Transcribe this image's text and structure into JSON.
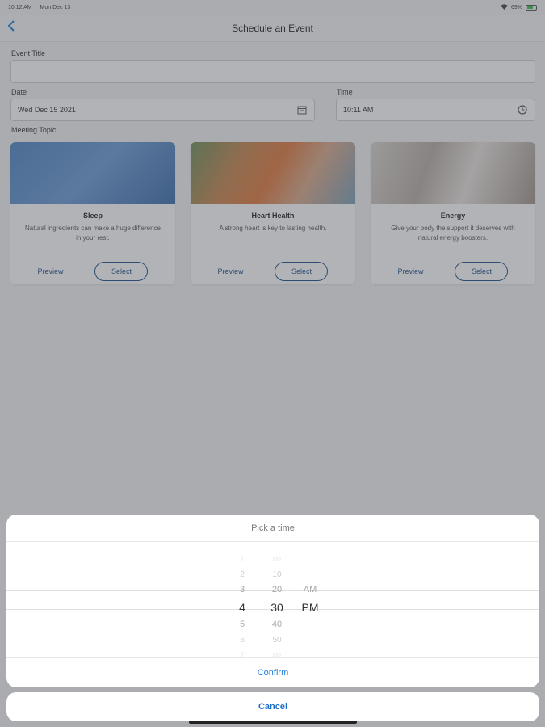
{
  "status": {
    "time": "10:12 AM",
    "date": "Mon Dec 13",
    "battery": "69%"
  },
  "nav": {
    "title": "Schedule an Event"
  },
  "form": {
    "event_title_label": "Event Title",
    "event_title_value": "",
    "date_label": "Date",
    "date_value": "Wed Dec 15 2021",
    "time_label": "Time",
    "time_value": "10:11 AM",
    "topic_label": "Meeting Topic"
  },
  "topics": [
    {
      "title": "Sleep",
      "desc": "Natural ingredients can make a huge difference in your rest.",
      "preview": "Preview",
      "select": "Select"
    },
    {
      "title": "Heart Health",
      "desc": "A strong heart is key to lasting health.",
      "preview": "Preview",
      "select": "Select"
    },
    {
      "title": "Energy",
      "desc": "Give your body the support it deserves with natural energy boosters.",
      "preview": "Preview",
      "select": "Select"
    }
  ],
  "picker": {
    "title": "Pick a time",
    "hours": [
      "1",
      "2",
      "3",
      "4",
      "5",
      "6",
      "7"
    ],
    "minutes": [
      "00",
      "10",
      "20",
      "30",
      "40",
      "50",
      "00"
    ],
    "periods": [
      "AM",
      "PM"
    ],
    "confirm": "Confirm",
    "cancel": "Cancel"
  },
  "colors": {
    "accent": "#1c7cd6",
    "dark_accent": "#1c4f8c"
  }
}
